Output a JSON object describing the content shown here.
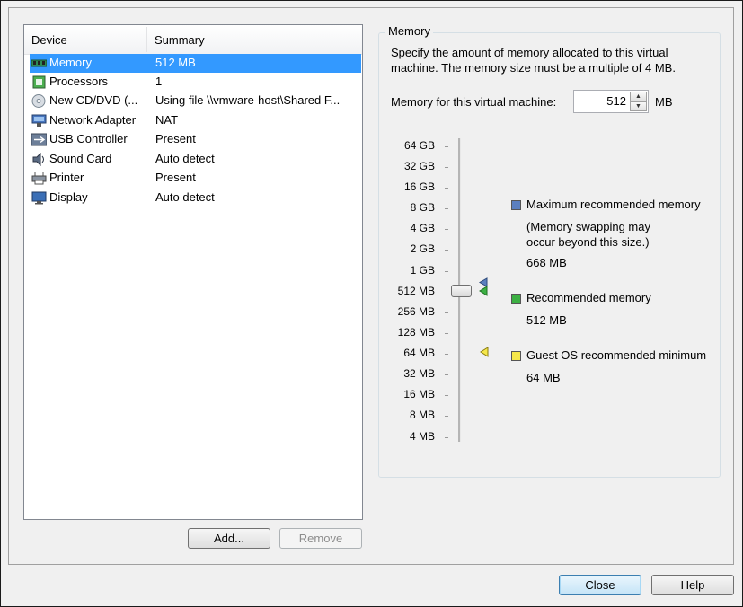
{
  "device_list": {
    "headers": {
      "device": "Device",
      "summary": "Summary"
    },
    "rows": [
      {
        "device": "Memory",
        "summary": "512 MB",
        "icon": "memory-icon",
        "selected": true
      },
      {
        "device": "Processors",
        "summary": "1",
        "icon": "processor-icon"
      },
      {
        "device": "New CD/DVD (...",
        "summary": "Using file \\\\vmware-host\\Shared F...",
        "icon": "cd-dvd-icon"
      },
      {
        "device": "Network Adapter",
        "summary": "NAT",
        "icon": "network-adapter-icon"
      },
      {
        "device": "USB Controller",
        "summary": "Present",
        "icon": "usb-icon"
      },
      {
        "device": "Sound Card",
        "summary": "Auto detect",
        "icon": "speaker-icon"
      },
      {
        "device": "Printer",
        "summary": "Present",
        "icon": "printer-icon"
      },
      {
        "device": "Display",
        "summary": "Auto detect",
        "icon": "monitor-icon"
      }
    ]
  },
  "buttons": {
    "add": "Add...",
    "remove": "Remove",
    "close": "Close",
    "help": "Help"
  },
  "memory": {
    "group_title": "Memory",
    "description": "Specify the amount of memory allocated to this virtual machine. The memory size must be a multiple of 4 MB.",
    "field_label": "Memory for this virtual machine:",
    "value": "512",
    "unit": "MB",
    "scale_ticks": [
      "64 GB",
      "32 GB",
      "16 GB",
      "8 GB",
      "4 GB",
      "2 GB",
      "1 GB",
      "512 MB",
      "256 MB",
      "128 MB",
      "64 MB",
      "32 MB",
      "16 MB",
      "8 MB",
      "4 MB"
    ],
    "slider_value": "512 MB",
    "legend": {
      "max_label": "Maximum recommended memory",
      "max_note": "(Memory swapping may occur beyond this size.)",
      "max_value": "668 MB",
      "rec_label": "Recommended memory",
      "rec_value": "512 MB",
      "min_label": "Guest OS recommended minimum",
      "min_value": "64 MB"
    },
    "colors": {
      "max": "#5b7fbf",
      "recommended": "#3cb043",
      "minimum": "#f5e74a"
    }
  }
}
